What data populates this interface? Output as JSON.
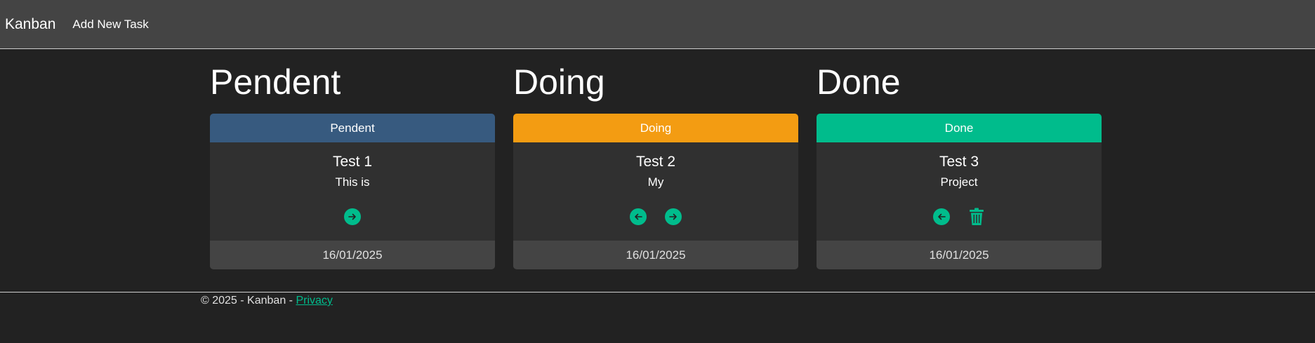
{
  "navbar": {
    "brand": "Kanban",
    "add_task": "Add New Task"
  },
  "columns": [
    {
      "title": "Pendent",
      "header_label": "Pendent",
      "header_color": "#375a7f",
      "task": {
        "title": "Test 1",
        "description": "This is",
        "date": "16/01/2025"
      },
      "actions": [
        "arrow-right-icon"
      ]
    },
    {
      "title": "Doing",
      "header_label": "Doing",
      "header_color": "#f39c12",
      "task": {
        "title": "Test 2",
        "description": "My",
        "date": "16/01/2025"
      },
      "actions": [
        "arrow-left-icon",
        "arrow-right-icon"
      ]
    },
    {
      "title": "Done",
      "header_label": "Done",
      "header_color": "#00bc8c",
      "task": {
        "title": "Test 3",
        "description": "Project",
        "date": "16/01/2025"
      },
      "actions": [
        "arrow-left-icon",
        "trash-icon"
      ]
    }
  ],
  "footer": {
    "text": "© 2025 - Kanban - ",
    "privacy_link": "Privacy"
  },
  "colors": {
    "accent": "#00bc8c",
    "background": "#222222",
    "navbar": "#444444",
    "card_body": "#303030"
  }
}
